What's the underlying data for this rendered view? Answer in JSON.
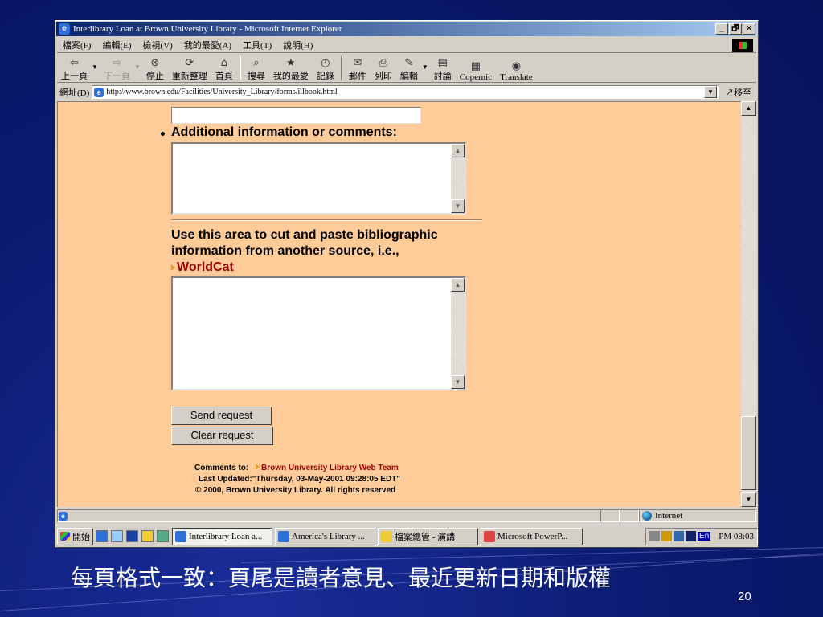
{
  "window": {
    "title": "Interlibrary Loan at Brown University Library - Microsoft Internet Explorer",
    "minimize": "_",
    "restore": "🗗",
    "close": "×"
  },
  "menu": [
    "檔案(F)",
    "編輯(E)",
    "檢視(V)",
    "我的最愛(A)",
    "工具(T)",
    "說明(H)"
  ],
  "toolbar": {
    "back": "上一頁",
    "forward": "下一頁",
    "stop": "停止",
    "refresh": "重新整理",
    "home": "首頁",
    "search": "搜尋",
    "favorites": "我的最愛",
    "history": "記錄",
    "mail": "郵件",
    "print": "列印",
    "edit": "編輯",
    "discuss": "討論",
    "copernic": "Copernic",
    "translate": "Translate"
  },
  "address": {
    "label": "網址(D)",
    "url": "http://www.brown.edu/Facilities/University_Library/forms/illbook.html",
    "go": "移至"
  },
  "form": {
    "additional_label": "Additional information or comments:",
    "cut_paste_label_1": "Use this area to cut and paste bibliographic",
    "cut_paste_label_2": "information from another source, i.e.,",
    "worldcat_link": "WorldCat",
    "send_button": "Send request",
    "clear_button": "Clear request"
  },
  "footer": {
    "comments_to": "Comments to:",
    "web_team_link": "Brown University Library Web Team",
    "last_updated": "Last Updated:\"Thursday, 03-May-2001 09:28:05 EDT\"",
    "copyright": "© 2000, Brown University Library. All rights reserved"
  },
  "status": {
    "zone": "Internet"
  },
  "taskbar": {
    "start": "開始",
    "tasks": [
      "Interlibrary Loan a...",
      "America's Library ...",
      "檔案總管 - 演講",
      "Microsoft PowerP..."
    ],
    "lang": "En",
    "clock": "PM 08:03"
  },
  "slide": {
    "caption": "每頁格式一致：頁尾是讀者意見、最近更新日期和版權",
    "number": "20"
  }
}
